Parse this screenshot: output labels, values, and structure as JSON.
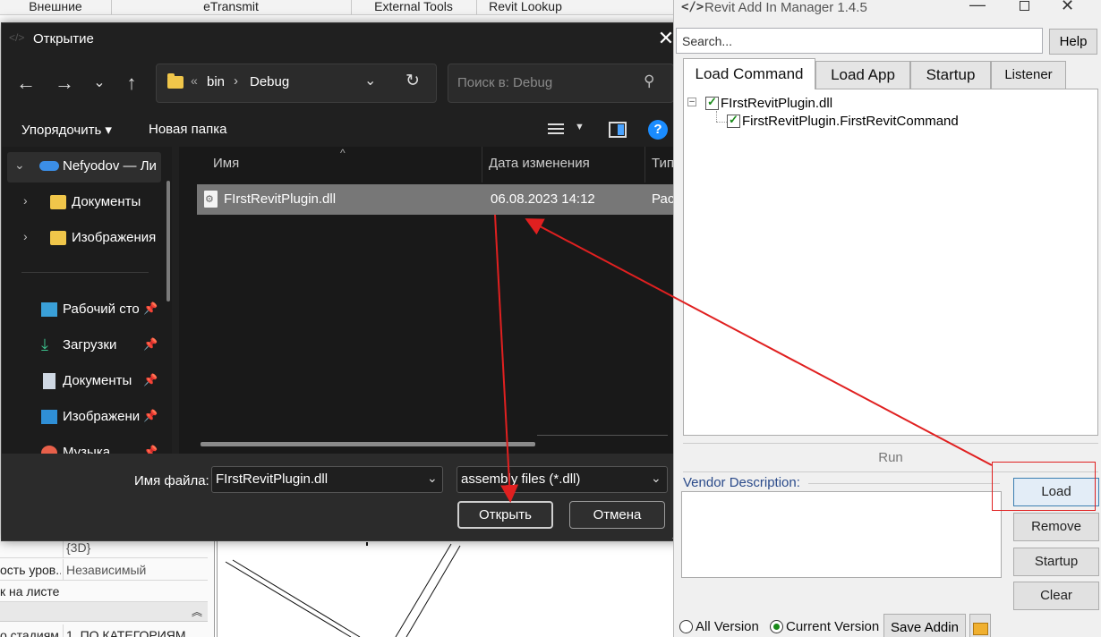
{
  "revit": {
    "ribbon_tabs": [
      "Внешние",
      "eTransmit",
      "External Tools",
      "Revit Lookup"
    ],
    "props": [
      {
        "name": "",
        "value": "{3D}"
      },
      {
        "name": "ость уров...",
        "value": "Независимый"
      },
      {
        "name": "к на листе",
        "value": ""
      }
    ],
    "bottom_row": {
      "name": "о стадиям",
      "value": "1. ПО КАТЕГОРИЯМ"
    },
    "collapse_icon": "chevron-up-icon"
  },
  "file_dialog": {
    "title": "Открытие",
    "close_icon": "close-icon",
    "breadcrumb": {
      "root_chevron": "«",
      "parts": [
        "bin",
        "Debug"
      ],
      "separator": "›"
    },
    "search_placeholder": "Поиск в: Debug",
    "commands": {
      "organize": "Упорядочить ▾",
      "new_folder": "Новая папка"
    },
    "nav": {
      "root": "Nefyodov — Ли",
      "folders": [
        "Документы",
        "Изображения"
      ],
      "quick": [
        "Рабочий сто",
        "Загрузки",
        "Документы",
        "Изображени",
        "Музыка"
      ]
    },
    "columns": {
      "name": "Имя",
      "date": "Дата изменения",
      "type": "Тип"
    },
    "files": [
      {
        "name": "FIrstRevitPlugin.dll",
        "date": "06.08.2023 14:12",
        "type": "Расш"
      }
    ],
    "footer": {
      "filename_label": "Имя файла:",
      "filename_value": "FIrstRevitPlugin.dll",
      "filetype_value": "assembly files (*.dll)",
      "open_label": "Открыть",
      "cancel_label": "Отмена"
    }
  },
  "addin_manager": {
    "title": "Revit Add In Manager 1.4.5",
    "search_placeholder": "Search...",
    "help_label": "Help",
    "tabs": [
      "Load Command",
      "Load App",
      "Startup",
      "Listener"
    ],
    "tree": {
      "root": "FIrstRevitPlugin.dll",
      "child": "FirstRevitPlugin.FirstRevitCommand"
    },
    "run_label": "Run",
    "vendor_label": "Vendor Description:",
    "buttons": {
      "load": "Load",
      "remove": "Remove",
      "startup": "Startup",
      "clear": "Clear"
    },
    "radios": {
      "all": "All Version",
      "current": "Current Version",
      "selected": "current"
    },
    "save_addin_label": "Save Addin"
  },
  "colors": {
    "annotation": "#e02020",
    "dialog_bg": "#202020",
    "accent": "#1a8cff"
  }
}
